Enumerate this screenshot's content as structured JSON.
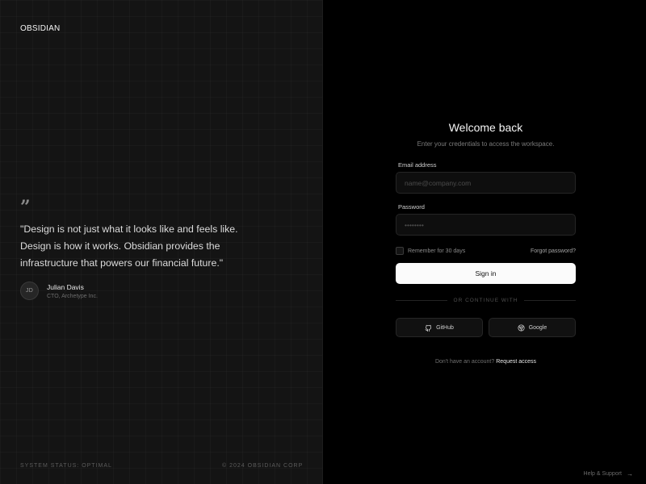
{
  "brand": {
    "name": "OBSIDIAN"
  },
  "testimonial": {
    "quote_mark": "”",
    "quote": "\"Design is not just what it looks like and feels like. Design is how it works. Obsidian provides the infrastructure that powers our financial future.\"",
    "author": {
      "initials": "JD",
      "name": "Julian Davis",
      "role": "CTO, Archetype Inc."
    }
  },
  "footer_left": {
    "status": "SYSTEM STATUS: OPTIMAL",
    "copyright": "© 2024 OBSIDIAN CORP"
  },
  "login": {
    "title": "Welcome back",
    "subtitle": "Enter your credentials to access the workspace.",
    "email_label": "Email address",
    "email_placeholder": "name@company.com",
    "password_label": "Password",
    "password_placeholder": "••••••••",
    "remember_label": "Remember for 30 days",
    "forgot_label": "Forgot password?",
    "signin_label": "Sign in",
    "divider_label": "OR CONTINUE WITH",
    "github_label": "GitHub",
    "google_label": "Google",
    "signup_prompt": "Don't have an account?",
    "signup_link": "Request access"
  },
  "help": {
    "label": "Help & Support",
    "arrow": "→"
  },
  "icons": {
    "github": "github-icon",
    "google": "google-icon"
  },
  "colors": {
    "background": "#000000",
    "panel_left": "#141414",
    "primary_button": "#fbfbfb"
  }
}
